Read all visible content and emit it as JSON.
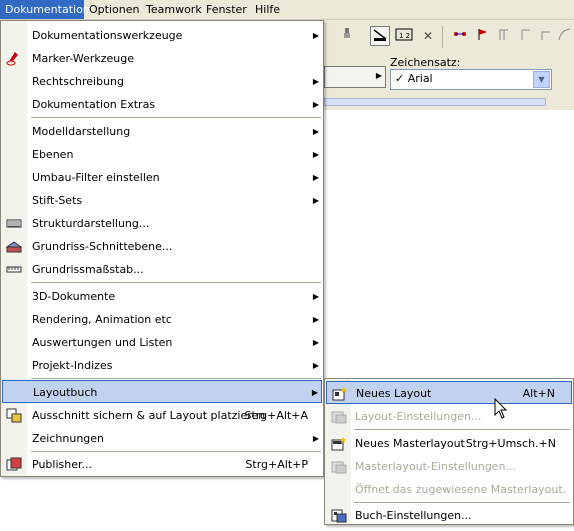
{
  "menubar": {
    "items": [
      {
        "label": "Dokumentation"
      },
      {
        "label": "Optionen"
      },
      {
        "label": "Teamwork"
      },
      {
        "label": "Fenster"
      },
      {
        "label": "Hilfe"
      }
    ]
  },
  "toolbar": {
    "charset_label": "Zeichensatz:",
    "charset_value": "✓ Arial",
    "icons": [
      "pen-icon",
      "scale-icon",
      "dimension-icon",
      "close-icon",
      "node-icon",
      "flag-icon",
      "stairs-icon",
      "step-icon",
      "corner-icon",
      "arc-icon",
      "curve-icon"
    ]
  },
  "menu": {
    "items": [
      {
        "label": "Dokumentationswerkzeuge",
        "submenu": true
      },
      {
        "label": "Marker-Werkzeuge",
        "icon": "marker-icon"
      },
      {
        "label": "Rechtschreibung",
        "submenu": true
      },
      {
        "label": "Dokumentation Extras",
        "submenu": true
      },
      {
        "label": "Modelldarstellung",
        "submenu": true
      },
      {
        "label": "Ebenen",
        "submenu": true
      },
      {
        "label": "Umbau-Filter einstellen",
        "submenu": true
      },
      {
        "label": "Stift-Sets",
        "submenu": true
      },
      {
        "label": "Strukturdarstellung...",
        "icon": "structure-icon"
      },
      {
        "label": "Grundriss-Schnittebene...",
        "icon": "section-plane-icon"
      },
      {
        "label": "Grundrissmaßstab...",
        "icon": "ruler-icon"
      },
      {
        "label": "3D-Dokumente",
        "submenu": true
      },
      {
        "label": "Rendering, Animation etc",
        "submenu": true
      },
      {
        "label": "Auswertungen und Listen",
        "submenu": true
      },
      {
        "label": "Projekt-Indizes",
        "submenu": true
      },
      {
        "label": "Layoutbuch",
        "submenu": true,
        "selected": true
      },
      {
        "label": "Ausschnitt sichern & auf Layout platzieren",
        "shortcut": "Strg+Alt+A",
        "icon": "save-view-icon"
      },
      {
        "label": "Zeichnungen",
        "submenu": true
      },
      {
        "label": "Publisher...",
        "shortcut": "Strg+Alt+P",
        "icon": "publisher-icon"
      }
    ]
  },
  "submenu": {
    "items": [
      {
        "label": "Neues Layout",
        "shortcut": "Alt+N",
        "icon": "new-layout-icon",
        "selected": true
      },
      {
        "label": "Layout-Einstellungen...",
        "disabled": true,
        "icon": "layout-settings-icon"
      },
      {
        "label": "Neues Masterlayout",
        "shortcut": "Strg+Umsch.+N",
        "icon": "new-master-icon"
      },
      {
        "label": "Masterlayout-Einstellungen...",
        "disabled": true,
        "icon": "master-settings-icon"
      },
      {
        "label": "Öffnet das zugewiesene Masterlayout.",
        "disabled": true
      },
      {
        "label": "Buch-Einstellungen...",
        "icon": "book-settings-icon"
      }
    ]
  }
}
